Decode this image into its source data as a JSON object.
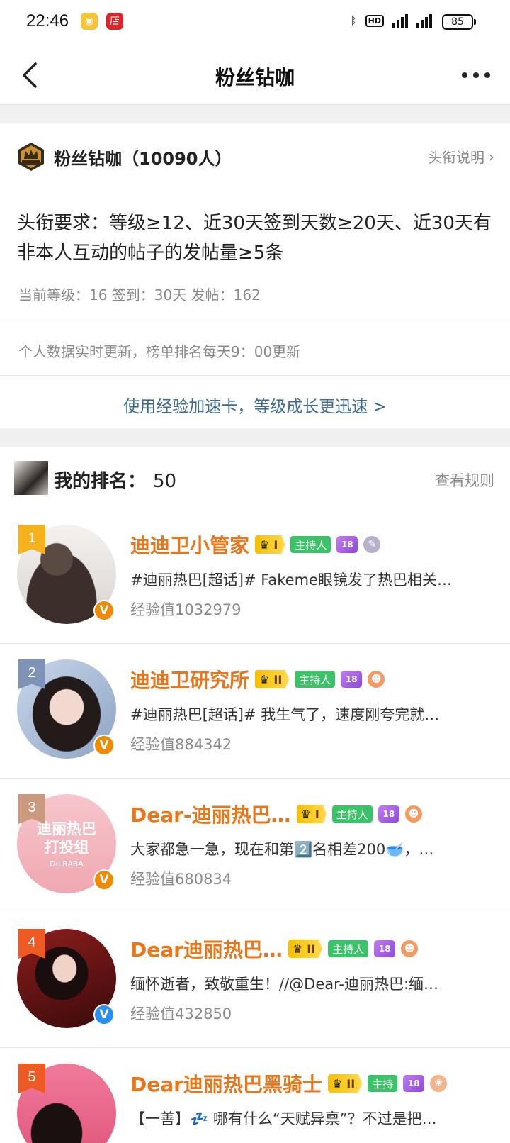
{
  "status_bar": {
    "time": "22:46",
    "app_icons": [
      "weibo-icon",
      "store-icon"
    ],
    "store_label": "店",
    "network": [
      "bluetooth",
      "HD",
      "4G",
      "5G"
    ],
    "battery": "85"
  },
  "nav": {
    "title": "粉丝钻咖",
    "back_icon": "back-arrow-icon",
    "more_icon": "more-dots-icon"
  },
  "summary": {
    "title": "粉丝钻咖（10090人）",
    "info_link": "头衔说明",
    "requirement": "头衔要求：等级≥12、近30天签到天数≥20天、近30天有非本人互动的帖子的发帖量≥5条",
    "current_stats": "当前等级：16 签到：30天 发帖：162",
    "update_note": "个人数据实时更新，榜单排名每天9：00更新",
    "boost_link": "使用经验加速卡，等级成长更迅速 >"
  },
  "my_rank": {
    "label": "我的排名：",
    "value": "50",
    "rules_link": "查看规则"
  },
  "ranking": [
    {
      "rank": "1",
      "name": "迪迪卫小管家",
      "level": "I",
      "host_label": "主持人",
      "gem_level": "18",
      "post": "#迪丽热巴[超话]# Fakeme眼镜发了热巴相关…",
      "exp": "经验值1032979",
      "verified": "orange",
      "flag_color": "#f5b21a"
    },
    {
      "rank": "2",
      "name": "迪迪卫研究所",
      "level": "II",
      "host_label": "主持人",
      "gem_level": "18",
      "post": "#迪丽热巴[超话]# 我生气了，速度刚夸完就…",
      "exp": "经验值884342",
      "verified": "orange",
      "flag_color": "#7f93b8"
    },
    {
      "rank": "3",
      "name": "Dear-迪丽热巴…",
      "level": "I",
      "host_label": "主持人",
      "gem_level": "18",
      "post": "大家都急一急，现在和第2️⃣名相差200🥣，…",
      "exp": "经验值680834",
      "verified": "orange",
      "flag_color": "#c99a7e",
      "avatar_text": "迪丽热巴打投组",
      "avatar_subtext": "DILRABA"
    },
    {
      "rank": "4",
      "name": "Dear迪丽热巴…",
      "level": "II",
      "host_label": "主持人",
      "gem_level": "18",
      "post": "缅怀逝者，致敬重生！//@Dear-迪丽热巴:缅…",
      "exp": "经验值432850",
      "verified": "blue",
      "flag_color": "#ee5a24"
    },
    {
      "rank": "5",
      "name": "Dear迪丽热巴黑骑士",
      "level": "II",
      "host_label": "主持",
      "gem_level": "18",
      "post": "【一善】💤 哪有什么“天赋异禀”？不过是把…",
      "exp": "",
      "verified": "orange",
      "flag_color": "#ee5a24"
    }
  ],
  "colors": {
    "name_orange": "#e8761a",
    "link_blue": "#3e6b96",
    "gray_text": "#8a8a8a",
    "host_green": "#3cc36a"
  }
}
